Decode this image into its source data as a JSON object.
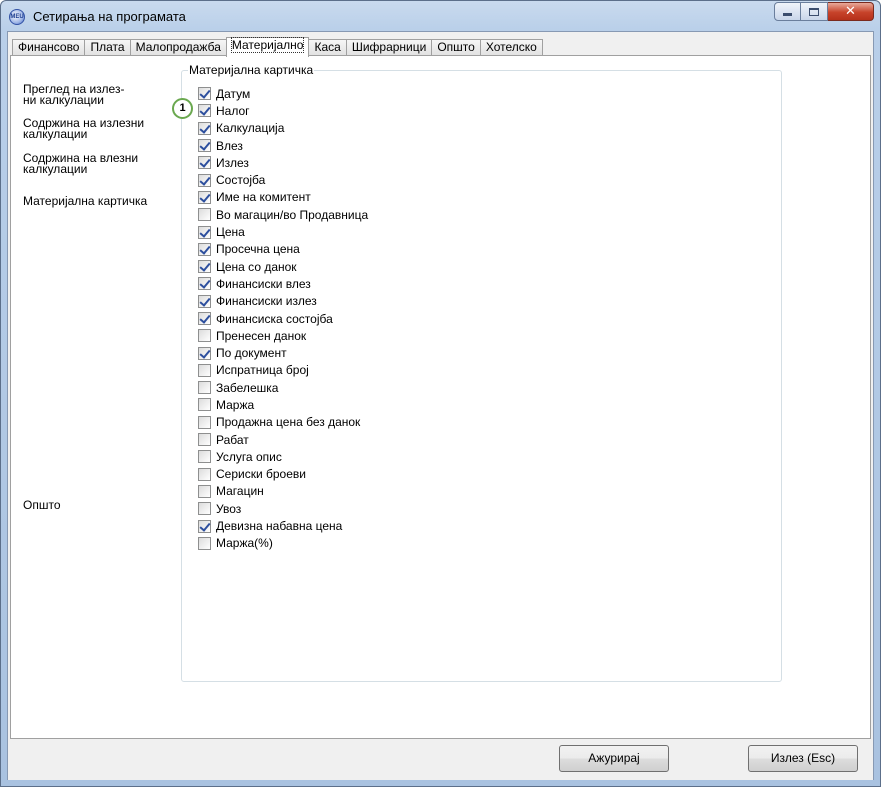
{
  "window": {
    "title": "Сетирања на програмата",
    "app_icon_text": "MEU",
    "close_symbol": "✕"
  },
  "tabs": [
    {
      "label": "Финансово",
      "active": false
    },
    {
      "label": "Плата",
      "active": false
    },
    {
      "label": "Малопродажба",
      "active": false
    },
    {
      "label": "Материјално",
      "active": true
    },
    {
      "label": "Каса",
      "active": false
    },
    {
      "label": "Шифрарници",
      "active": false
    },
    {
      "label": "Општо",
      "active": false
    },
    {
      "label": "Хотелско",
      "active": false
    }
  ],
  "sidebar": {
    "items": [
      {
        "label_line1": "Преглед на излез-",
        "label_line2": "ни калкулации"
      },
      {
        "label_line1": "Содржина на излезни",
        "label_line2": "калкулации"
      },
      {
        "label_line1": "Содржина на влезни",
        "label_line2": "калкулации"
      },
      {
        "label_line1": "Материјална картичка",
        "label_line2": ""
      },
      {
        "label_line1": "Општо",
        "label_line2": ""
      }
    ]
  },
  "callout": {
    "number": "1"
  },
  "groupbox": {
    "title": "Материјална картичка",
    "options": [
      {
        "label": "Датум",
        "checked": true
      },
      {
        "label": "Налог",
        "checked": true
      },
      {
        "label": "Калкулација",
        "checked": true
      },
      {
        "label": "Влез",
        "checked": true
      },
      {
        "label": "Излез",
        "checked": true
      },
      {
        "label": "Состојба",
        "checked": true
      },
      {
        "label": "Име на комитент",
        "checked": true
      },
      {
        "label": "Во магацин/во Продавница",
        "checked": false
      },
      {
        "label": "Цена",
        "checked": true
      },
      {
        "label": "Просечна цена",
        "checked": true
      },
      {
        "label": "Цена со данок",
        "checked": true
      },
      {
        "label": "Финансиски влез",
        "checked": true
      },
      {
        "label": "Финансиски излез",
        "checked": true
      },
      {
        "label": "Финансиска состојба",
        "checked": true
      },
      {
        "label": "Пренесен данок",
        "checked": false
      },
      {
        "label": "По документ",
        "checked": true
      },
      {
        "label": "Испратница број",
        "checked": false
      },
      {
        "label": "Забелешка",
        "checked": false
      },
      {
        "label": "Маржа",
        "checked": false
      },
      {
        "label": "Продажна цена без данок",
        "checked": false
      },
      {
        "label": "Рабат",
        "checked": false
      },
      {
        "label": "Услуга опис",
        "checked": false
      },
      {
        "label": "Сериски броеви",
        "checked": false
      },
      {
        "label": "Магацин",
        "checked": false
      },
      {
        "label": "Увоз",
        "checked": false
      },
      {
        "label": "Девизна набавна цена",
        "checked": true
      },
      {
        "label": "Маржа(%)",
        "checked": false
      }
    ]
  },
  "buttons": {
    "update_label": "Ажурирај",
    "exit_label": "Излез (Esc)"
  },
  "colors": {
    "frame": "#b9cfe9",
    "check": "#2d4f9e",
    "callout_border": "#6aa84f"
  }
}
